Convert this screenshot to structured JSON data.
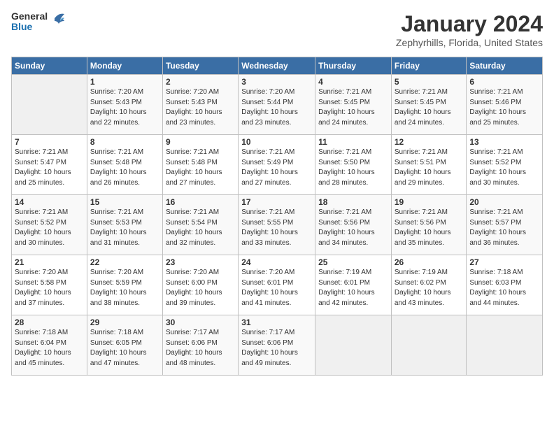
{
  "header": {
    "logo_line1": "General",
    "logo_line2": "Blue",
    "month": "January 2024",
    "location": "Zephyrhills, Florida, United States"
  },
  "weekdays": [
    "Sunday",
    "Monday",
    "Tuesday",
    "Wednesday",
    "Thursday",
    "Friday",
    "Saturday"
  ],
  "weeks": [
    [
      {
        "day": "",
        "info": ""
      },
      {
        "day": "1",
        "info": "Sunrise: 7:20 AM\nSunset: 5:43 PM\nDaylight: 10 hours\nand 22 minutes."
      },
      {
        "day": "2",
        "info": "Sunrise: 7:20 AM\nSunset: 5:43 PM\nDaylight: 10 hours\nand 23 minutes."
      },
      {
        "day": "3",
        "info": "Sunrise: 7:20 AM\nSunset: 5:44 PM\nDaylight: 10 hours\nand 23 minutes."
      },
      {
        "day": "4",
        "info": "Sunrise: 7:21 AM\nSunset: 5:45 PM\nDaylight: 10 hours\nand 24 minutes."
      },
      {
        "day": "5",
        "info": "Sunrise: 7:21 AM\nSunset: 5:45 PM\nDaylight: 10 hours\nand 24 minutes."
      },
      {
        "day": "6",
        "info": "Sunrise: 7:21 AM\nSunset: 5:46 PM\nDaylight: 10 hours\nand 25 minutes."
      }
    ],
    [
      {
        "day": "7",
        "info": "Sunrise: 7:21 AM\nSunset: 5:47 PM\nDaylight: 10 hours\nand 25 minutes."
      },
      {
        "day": "8",
        "info": "Sunrise: 7:21 AM\nSunset: 5:48 PM\nDaylight: 10 hours\nand 26 minutes."
      },
      {
        "day": "9",
        "info": "Sunrise: 7:21 AM\nSunset: 5:48 PM\nDaylight: 10 hours\nand 27 minutes."
      },
      {
        "day": "10",
        "info": "Sunrise: 7:21 AM\nSunset: 5:49 PM\nDaylight: 10 hours\nand 27 minutes."
      },
      {
        "day": "11",
        "info": "Sunrise: 7:21 AM\nSunset: 5:50 PM\nDaylight: 10 hours\nand 28 minutes."
      },
      {
        "day": "12",
        "info": "Sunrise: 7:21 AM\nSunset: 5:51 PM\nDaylight: 10 hours\nand 29 minutes."
      },
      {
        "day": "13",
        "info": "Sunrise: 7:21 AM\nSunset: 5:52 PM\nDaylight: 10 hours\nand 30 minutes."
      }
    ],
    [
      {
        "day": "14",
        "info": "Sunrise: 7:21 AM\nSunset: 5:52 PM\nDaylight: 10 hours\nand 30 minutes."
      },
      {
        "day": "15",
        "info": "Sunrise: 7:21 AM\nSunset: 5:53 PM\nDaylight: 10 hours\nand 31 minutes."
      },
      {
        "day": "16",
        "info": "Sunrise: 7:21 AM\nSunset: 5:54 PM\nDaylight: 10 hours\nand 32 minutes."
      },
      {
        "day": "17",
        "info": "Sunrise: 7:21 AM\nSunset: 5:55 PM\nDaylight: 10 hours\nand 33 minutes."
      },
      {
        "day": "18",
        "info": "Sunrise: 7:21 AM\nSunset: 5:56 PM\nDaylight: 10 hours\nand 34 minutes."
      },
      {
        "day": "19",
        "info": "Sunrise: 7:21 AM\nSunset: 5:56 PM\nDaylight: 10 hours\nand 35 minutes."
      },
      {
        "day": "20",
        "info": "Sunrise: 7:21 AM\nSunset: 5:57 PM\nDaylight: 10 hours\nand 36 minutes."
      }
    ],
    [
      {
        "day": "21",
        "info": "Sunrise: 7:20 AM\nSunset: 5:58 PM\nDaylight: 10 hours\nand 37 minutes."
      },
      {
        "day": "22",
        "info": "Sunrise: 7:20 AM\nSunset: 5:59 PM\nDaylight: 10 hours\nand 38 minutes."
      },
      {
        "day": "23",
        "info": "Sunrise: 7:20 AM\nSunset: 6:00 PM\nDaylight: 10 hours\nand 39 minutes."
      },
      {
        "day": "24",
        "info": "Sunrise: 7:20 AM\nSunset: 6:01 PM\nDaylight: 10 hours\nand 41 minutes."
      },
      {
        "day": "25",
        "info": "Sunrise: 7:19 AM\nSunset: 6:01 PM\nDaylight: 10 hours\nand 42 minutes."
      },
      {
        "day": "26",
        "info": "Sunrise: 7:19 AM\nSunset: 6:02 PM\nDaylight: 10 hours\nand 43 minutes."
      },
      {
        "day": "27",
        "info": "Sunrise: 7:18 AM\nSunset: 6:03 PM\nDaylight: 10 hours\nand 44 minutes."
      }
    ],
    [
      {
        "day": "28",
        "info": "Sunrise: 7:18 AM\nSunset: 6:04 PM\nDaylight: 10 hours\nand 45 minutes."
      },
      {
        "day": "29",
        "info": "Sunrise: 7:18 AM\nSunset: 6:05 PM\nDaylight: 10 hours\nand 47 minutes."
      },
      {
        "day": "30",
        "info": "Sunrise: 7:17 AM\nSunset: 6:06 PM\nDaylight: 10 hours\nand 48 minutes."
      },
      {
        "day": "31",
        "info": "Sunrise: 7:17 AM\nSunset: 6:06 PM\nDaylight: 10 hours\nand 49 minutes."
      },
      {
        "day": "",
        "info": ""
      },
      {
        "day": "",
        "info": ""
      },
      {
        "day": "",
        "info": ""
      }
    ]
  ]
}
